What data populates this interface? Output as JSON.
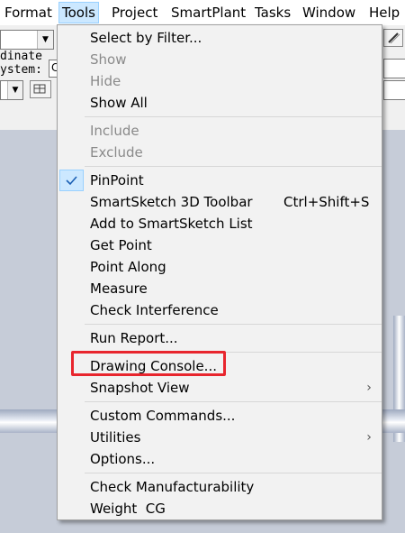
{
  "menubar": {
    "items": [
      {
        "label": "Format",
        "active": false
      },
      {
        "label": "Tools",
        "active": true
      },
      {
        "label": "Project",
        "active": false
      },
      {
        "label": "SmartPlant",
        "active": false
      },
      {
        "label": "Tasks",
        "active": false
      },
      {
        "label": "Window",
        "active": false
      },
      {
        "label": "Help",
        "active": false
      }
    ]
  },
  "background": {
    "coord_line1": "dinate",
    "coord_line2": "ystem:",
    "coord_field_value": "C"
  },
  "tools_menu": {
    "items": [
      {
        "label": "Select by Filter...",
        "enabled": true
      },
      {
        "label": "Show",
        "enabled": false
      },
      {
        "label": "Hide",
        "enabled": false
      },
      {
        "label": "Show All",
        "enabled": true
      },
      {
        "label": "Include",
        "enabled": false
      },
      {
        "label": "Exclude",
        "enabled": false
      },
      {
        "label": "PinPoint",
        "enabled": true,
        "checked": true
      },
      {
        "label": "SmartSketch 3D Toolbar",
        "enabled": true,
        "shortcut": "Ctrl+Shift+S"
      },
      {
        "label": "Add to SmartSketch List",
        "enabled": true
      },
      {
        "label": "Get Point",
        "enabled": true
      },
      {
        "label": "Point Along",
        "enabled": true
      },
      {
        "label": "Measure",
        "enabled": true
      },
      {
        "label": "Check Interference",
        "enabled": true
      },
      {
        "label": "Run Report...",
        "enabled": true
      },
      {
        "label": "Drawing Console...",
        "enabled": true,
        "highlighted": true
      },
      {
        "label": "Snapshot View",
        "enabled": true,
        "submenu": true
      },
      {
        "label": "Custom Commands...",
        "enabled": true
      },
      {
        "label": "Utilities",
        "enabled": true,
        "submenu": true
      },
      {
        "label": "Options...",
        "enabled": true
      },
      {
        "label": "Check Manufacturability",
        "enabled": true
      },
      {
        "label": "Weight  CG",
        "enabled": true
      }
    ],
    "checkmark_icon": "checkmark-icon",
    "submenu_icon": "chevron-right-icon",
    "highlight_color": "#e8262e",
    "check_bg_color": "#cce8ff"
  }
}
